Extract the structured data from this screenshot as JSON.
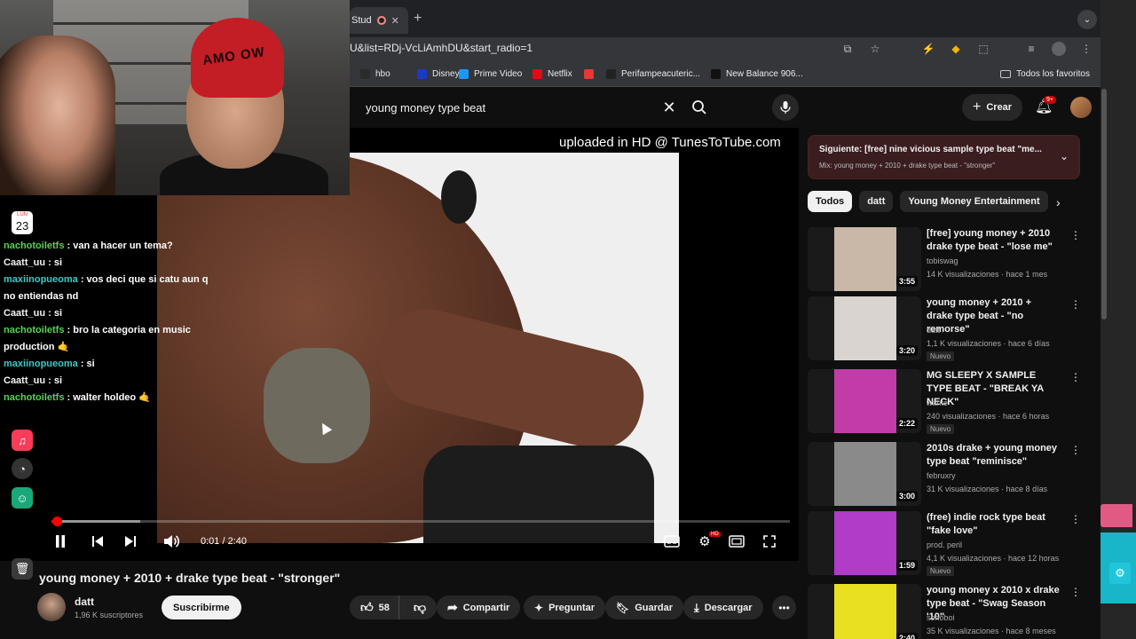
{
  "browser": {
    "tab_label": "Stud",
    "url": "U&list=RDj-VcLiAmhDU&start_radio=1",
    "bookmarks": [
      {
        "label": "hbo",
        "color": "#2b2b2b"
      },
      {
        "label": "Disney+",
        "color": "#1a3cc4"
      },
      {
        "label": "Prime Video",
        "color": "#1a98ff"
      },
      {
        "label": "Netflix",
        "color": "#e50914"
      },
      {
        "label": "",
        "color": "#e53935"
      },
      {
        "label": "Perifampeacuteric...",
        "color": "#222222"
      },
      {
        "label": "New Balance 906...",
        "color": "#111111"
      }
    ],
    "all_bookmarks": "Todos los favoritos"
  },
  "header": {
    "search_value": "young money type beat",
    "create_label": "Crear",
    "notifications_badge": "9+"
  },
  "player": {
    "watermark": "uploaded in HD @ TunesToTube.com",
    "time": "0:01 / 2:40",
    "progress_fraction": 0.006,
    "hd_badge": "HD"
  },
  "video": {
    "title": "young money + 2010 + drake type beat - \"stronger\"",
    "channel": "datt",
    "subscribers": "1,96 K suscriptores",
    "subscribe_label": "Suscribirme",
    "likes": "58",
    "share_label": "Compartir",
    "ask_label": "Preguntar",
    "save_label": "Guardar",
    "download_label": "Descargar"
  },
  "up_next": {
    "title": "Siguiente: [free] nine vicious sample type beat \"me...",
    "subtitle": "Mix: young money + 2010 + drake type beat - \"stronger\""
  },
  "chips": [
    "Todos",
    "datt",
    "Young Money Entertainment"
  ],
  "recommendations": [
    {
      "title": "[free] young money + 2010 drake type beat - \"lose me\"",
      "channel": "tobiswag",
      "meta": "14 K visualizaciones · hace 1 mes",
      "duration": "3:55",
      "new": "",
      "thumb_color": "#c9b8a8"
    },
    {
      "title": "young money + 2010 + drake type beat - \"no remorse\"",
      "channel": "datt",
      "meta": "1,1 K visualizaciones · hace 6 días",
      "duration": "3:20",
      "new": "Nuevo",
      "thumb_color": "#d9d4cf"
    },
    {
      "title": "MG SLEEPY X SAMPLE TYPE BEAT - \"BREAK YA NECK\"",
      "channel": "wante",
      "meta": "240 visualizaciones · hace 6 horas",
      "duration": "2:22",
      "new": "Nuevo",
      "thumb_color": "#c23ca8"
    },
    {
      "title": "2010s drake + young money type beat \"reminisce\"",
      "channel": "februxry",
      "meta": "31 K visualizaciones · hace 8 días",
      "duration": "3:00",
      "new": "",
      "thumb_color": "#8a8a8a"
    },
    {
      "title": "(free) indie rock type beat \"fake love\"",
      "channel": "prod. peril",
      "meta": "4,1 K visualizaciones · hace 12 horas",
      "duration": "1:59",
      "new": "Nuevo",
      "thumb_color": "#b03cc8"
    },
    {
      "title": "young money x 2010 x drake type beat - \"Swag Season '10\"",
      "channel": "sohoboi",
      "meta": "35 K visualizaciones · hace 8 meses",
      "duration": "2:40",
      "new": "",
      "thumb_color": "#e8e020"
    }
  ],
  "webcam": {
    "hat_text": "AMO OW"
  },
  "dock": {
    "calendar_month": "LUN",
    "calendar_day": "23"
  },
  "chat": [
    {
      "user": "nachotoiletfs",
      "color": "green",
      "message": ": van a hacer un tema?"
    },
    {
      "user": "Caatt_uu",
      "color": "white",
      "message": ": si"
    },
    {
      "user": "maxiinopueoma",
      "color": "cyan",
      "message": ": vos deci que si catu aun q no entiendas nd"
    },
    {
      "user": "Caatt_uu",
      "color": "white",
      "message": ": si"
    },
    {
      "user": "nachotoiletfs",
      "color": "green",
      "message": ": bro la categoria en music production 🤙"
    },
    {
      "user": "maxiinopueoma",
      "color": "cyan",
      "message": ": si"
    },
    {
      "user": "Caatt_uu",
      "color": "white",
      "message": ": si"
    },
    {
      "user": "nachotoiletfs",
      "color": "green",
      "message": ": walter holdeo 🤙"
    }
  ]
}
